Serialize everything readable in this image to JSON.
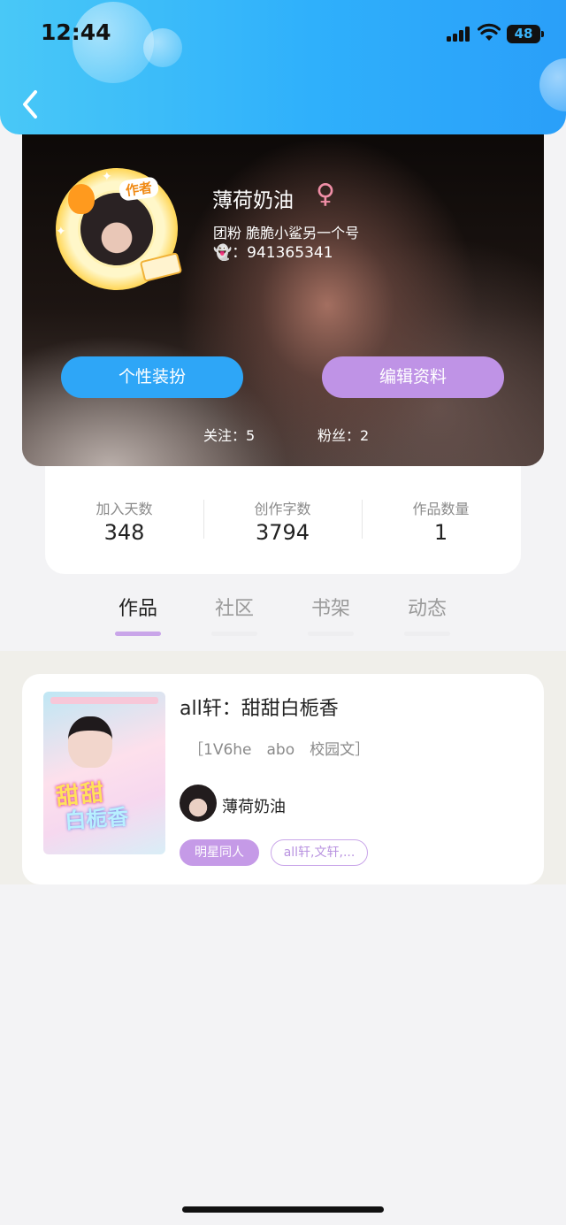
{
  "status_bar": {
    "time": "12:44",
    "battery": "48"
  },
  "profile": {
    "author_badge": "作者",
    "nickname": "薄荷奶油",
    "gender_symbol": "♀",
    "fan_text": "团粉 脆脆小鲨另一个号",
    "qq_icon": "👻",
    "qq_number": "：941365341",
    "dress_button": "个性装扮",
    "edit_button": "编辑资料",
    "following": "关注：5",
    "fans": "粉丝：2"
  },
  "stats": [
    {
      "label": "加入天数",
      "value": "348"
    },
    {
      "label": "创作字数",
      "value": "3794"
    },
    {
      "label": "作品数量",
      "value": "1"
    }
  ],
  "tabs": [
    {
      "label": "作品",
      "active": true
    },
    {
      "label": "社区",
      "active": false
    },
    {
      "label": "书架",
      "active": false
    },
    {
      "label": "动态",
      "active": false
    }
  ],
  "work": {
    "title": "all轩：甜甜白栀香",
    "tags": "［1V6he　abo　校园文］",
    "author": "薄荷奶油",
    "category": "明星同人",
    "keywords": "all轩,文轩,...",
    "cover_title_line1": "甜甜",
    "cover_title_line2": "白栀香"
  },
  "colors": {
    "header": "#2fb0fb",
    "dress_button": "#2ea6f7",
    "edit_button": "#bf93e6",
    "tab_indicator": "#c9a5e9",
    "category_pill": "#c59ae7"
  }
}
